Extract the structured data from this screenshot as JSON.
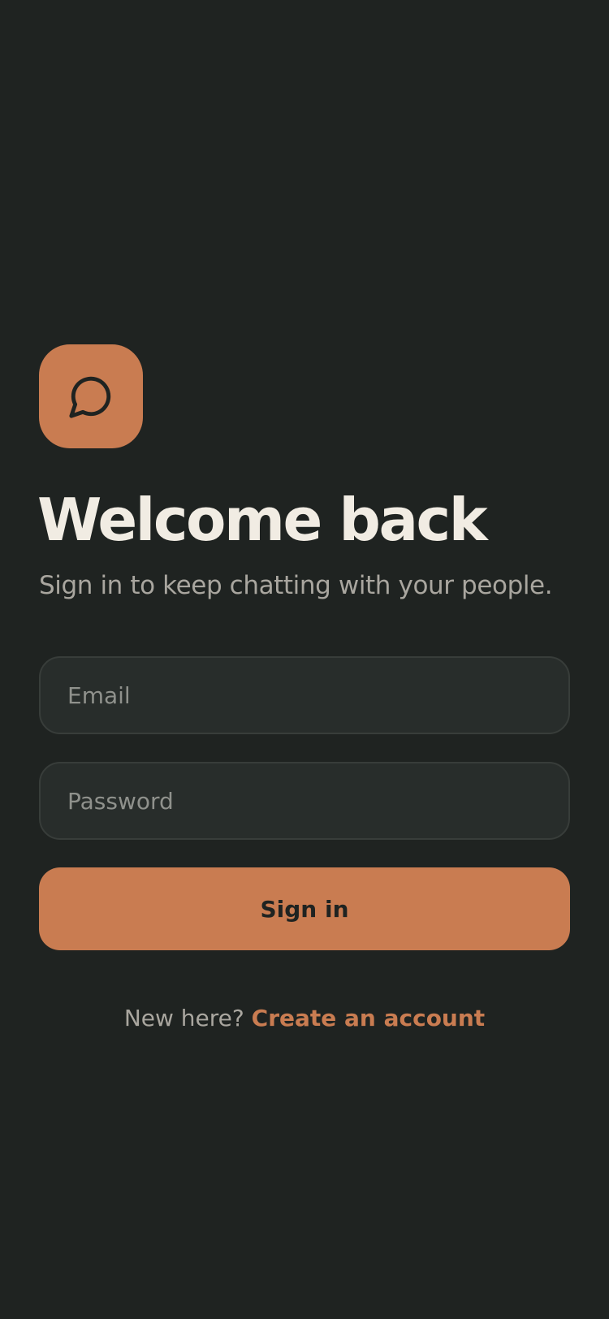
{
  "brand": {
    "icon": "chat-bubble-icon",
    "accent_color": "#c97c51",
    "background_color": "#1f2321"
  },
  "header": {
    "title": "Welcome back",
    "subtitle": "Sign in to keep chatting with your people."
  },
  "form": {
    "email": {
      "placeholder": "Email",
      "value": ""
    },
    "password": {
      "placeholder": "Password",
      "value": ""
    },
    "submit_label": "Sign in"
  },
  "footer": {
    "prompt": "New here?",
    "link_label": "Create an account"
  }
}
